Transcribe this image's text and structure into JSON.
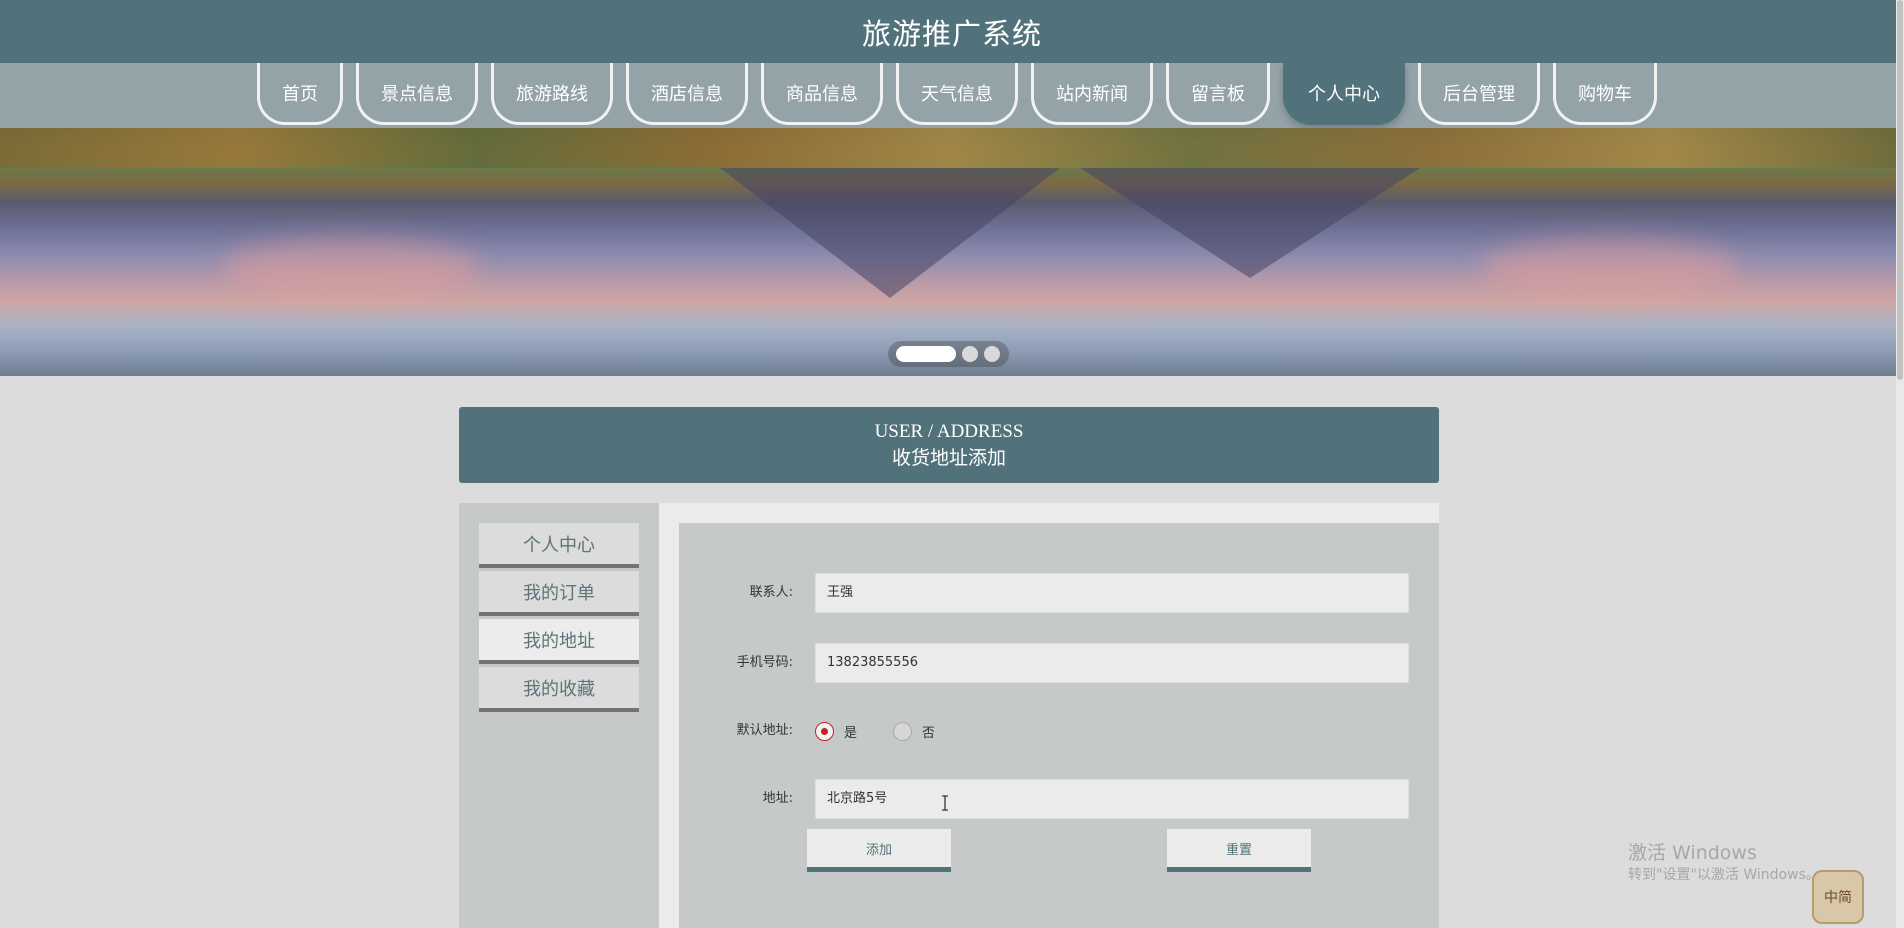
{
  "header": {
    "title": "旅游推广系统"
  },
  "nav": {
    "items": [
      {
        "label": "首页"
      },
      {
        "label": "景点信息"
      },
      {
        "label": "旅游路线"
      },
      {
        "label": "酒店信息"
      },
      {
        "label": "商品信息"
      },
      {
        "label": "天气信息"
      },
      {
        "label": "站内新闻"
      },
      {
        "label": "留言板"
      },
      {
        "label": "个人中心"
      },
      {
        "label": "后台管理"
      },
      {
        "label": "购物车"
      }
    ],
    "active": "个人中心"
  },
  "banner": {
    "slide_count": 3,
    "current_slide": 1
  },
  "section": {
    "title_en": "USER / ADDRESS",
    "title_cn": "收货地址添加"
  },
  "sidebar": {
    "items": [
      {
        "label": "个人中心"
      },
      {
        "label": "我的订单"
      },
      {
        "label": "我的地址"
      },
      {
        "label": "我的收藏"
      }
    ],
    "active": "我的地址"
  },
  "form": {
    "contact_label": "联系人:",
    "contact_value": "王强",
    "phone_label": "手机号码:",
    "phone_value": "13823855556",
    "default_label": "默认地址:",
    "default_options": [
      "是",
      "否"
    ],
    "default_selected": "是",
    "address_label": "地址:",
    "address_value": "北京路5号",
    "submit_label": "添加",
    "reset_label": "重置"
  },
  "watermark": {
    "line1": "激活 Windows",
    "line2": "转到\"设置\"以激活 Windows。"
  },
  "ime": {
    "label": "中简"
  },
  "colors": {
    "primary": "#52727b",
    "nav": "#94a3a8",
    "background": "#dcdcdc",
    "radio_accent": "#c7202a"
  }
}
